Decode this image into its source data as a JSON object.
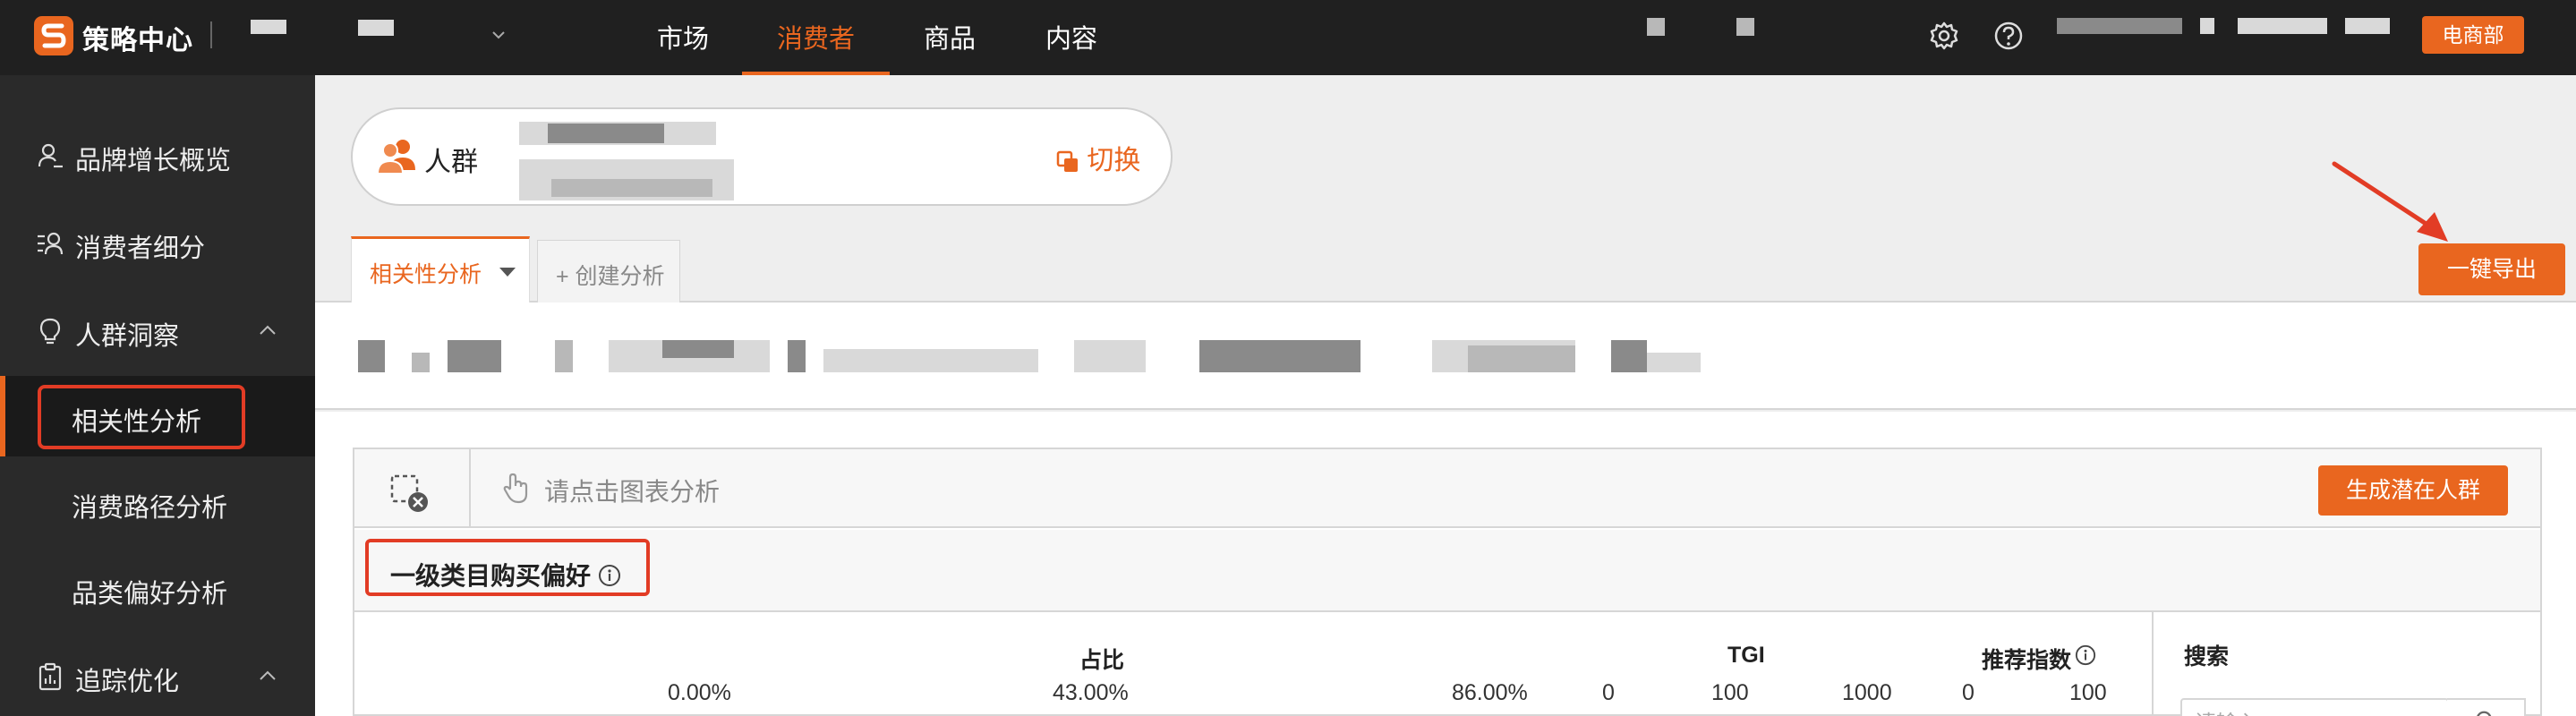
{
  "topbar": {
    "app_title": "策略中心",
    "nav": [
      {
        "label": "市场"
      },
      {
        "label": "消费者"
      },
      {
        "label": "商品"
      },
      {
        "label": "内容"
      }
    ],
    "dept_label": "电商部",
    "icons": [
      "settings-icon",
      "help-icon"
    ]
  },
  "sidebar": {
    "items": [
      {
        "label": "品牌增长概览"
      },
      {
        "label": "消费者细分"
      },
      {
        "label": "人群洞察"
      },
      {
        "label": "相关性分析"
      },
      {
        "label": "消费路径分析"
      },
      {
        "label": "品类偏好分析"
      },
      {
        "label": "追踪优化"
      }
    ]
  },
  "crowd": {
    "label": "人群",
    "switch_label": "切换"
  },
  "tabs": {
    "active": "相关性分析",
    "create": "创建分析"
  },
  "export_label": "一键导出",
  "analysis": {
    "hint": "请点击图表分析",
    "generate_label": "生成潜在人群",
    "section_title": "一级类目购买偏好",
    "columns": {
      "share": "占比",
      "tgi": "TGI",
      "recommend": "推荐指数"
    },
    "share_axis": [
      "0.00%",
      "43.00%",
      "86.00%"
    ],
    "tgi_axis": [
      "0",
      "100",
      "1000"
    ],
    "recommend_axis": [
      "0",
      "100"
    ],
    "search_label": "搜索",
    "search_placeholder": "请输入"
  },
  "colors": {
    "accent": "#e9661f",
    "highlight": "#e23c25",
    "topbar_bg": "#202020",
    "sidebar_bg": "#2a2a2a"
  }
}
